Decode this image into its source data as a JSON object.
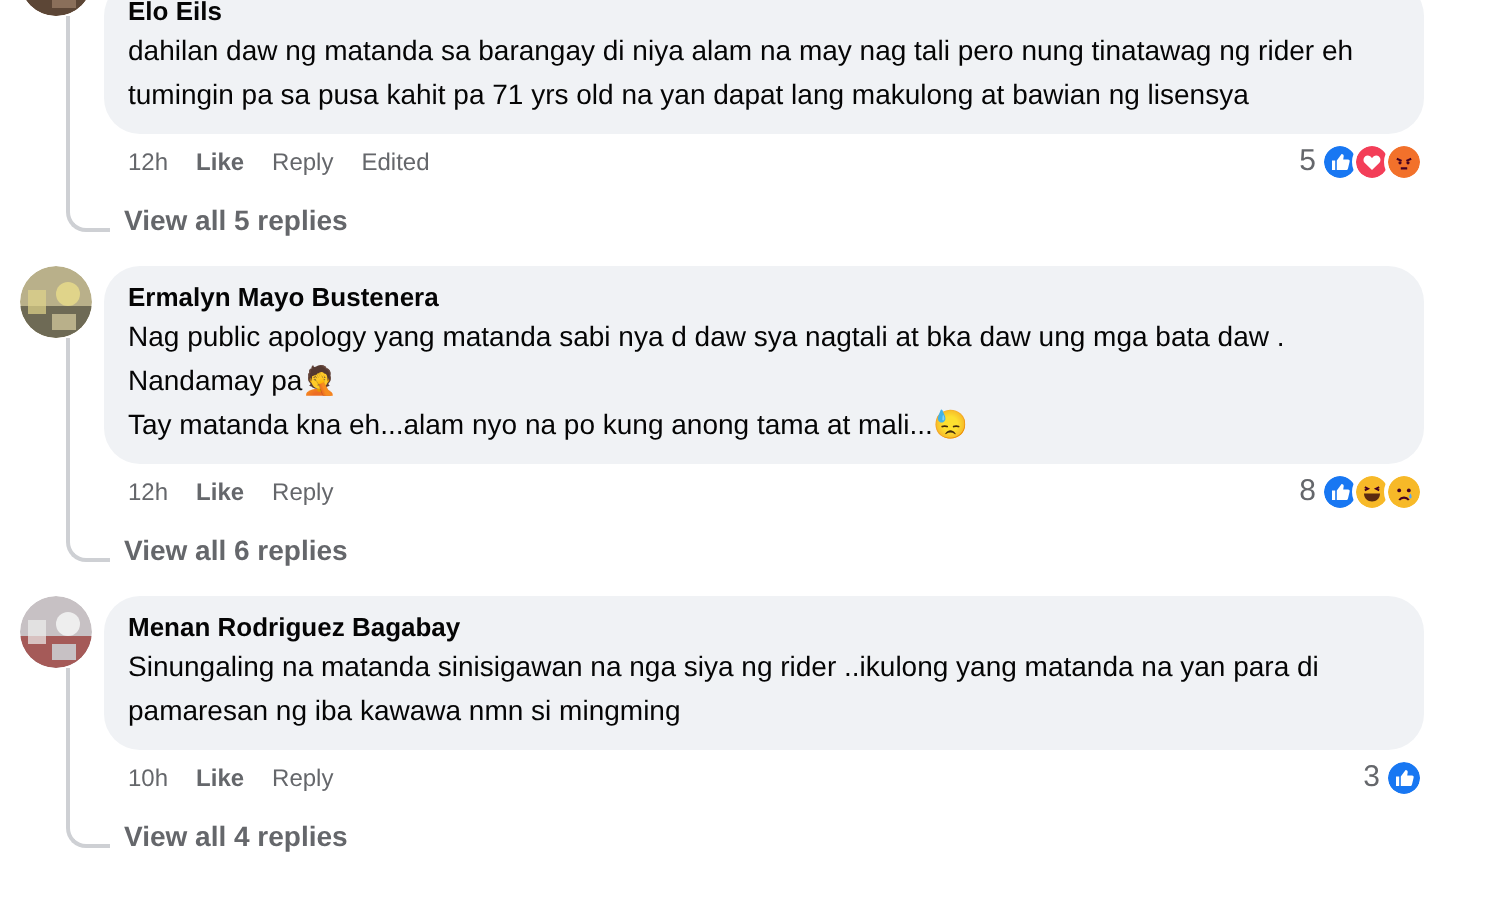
{
  "comments": [
    {
      "author": "Elo Eils",
      "text": [
        "dahilan daw ng matanda sa barangay di niya alam na may nag tali pero nung tinatawag ng rider eh tumingin pa sa pusa kahit pa 71 yrs old na yan dapat lang makulong at bawian ng lisensya"
      ],
      "time": "12h",
      "like": "Like",
      "reply": "Reply",
      "edited": "Edited",
      "reaction_count": "5",
      "reactions": [
        {
          "kind": "like"
        },
        {
          "kind": "love"
        },
        {
          "kind": "angry"
        }
      ],
      "view_replies": "View all 5 replies"
    },
    {
      "author": "Ermalyn Mayo Bustenera",
      "text": [
        "Nag public apology yang matanda sabi nya d daw sya nagtali at bka daw ung mga bata daw . Nandamay pa🤦",
        "Tay matanda kna eh...alam nyo na po kung anong tama at mali...😓"
      ],
      "time": "12h",
      "like": "Like",
      "reply": "Reply",
      "reaction_count": "8",
      "reactions": [
        {
          "kind": "like"
        },
        {
          "kind": "haha"
        },
        {
          "kind": "sad"
        }
      ],
      "view_replies": "View all 6 replies"
    },
    {
      "author": "Menan Rodriguez Bagabay",
      "text": [
        "Sinungaling na matanda sinisigawan na nga siya ng rider ..ikulong yang matanda na yan para di pamaresan ng iba kawawa nmn si mingming"
      ],
      "time": "10h",
      "like": "Like",
      "reply": "Reply",
      "reaction_count": "3",
      "reactions": [
        {
          "kind": "like"
        }
      ],
      "view_replies": "View all 4 replies"
    }
  ]
}
